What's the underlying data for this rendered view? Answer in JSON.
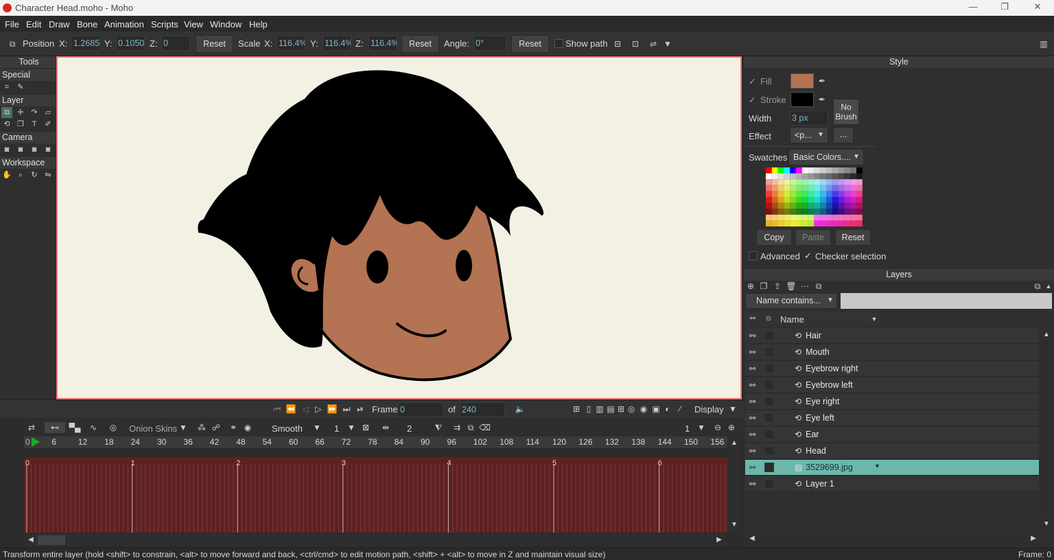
{
  "window": {
    "title": "Character Head.moho - Moho",
    "minimize": "—",
    "maximize": "❐",
    "close": "✕"
  },
  "menu": [
    "File",
    "Edit",
    "Draw",
    "Bone",
    "Animation",
    "Scripts",
    "View",
    "Window",
    "Help"
  ],
  "toolbar": {
    "position_label": "Position",
    "x_label": "X:",
    "x_value": "1.2685",
    "y_label": "Y:",
    "y_value": "0.1050",
    "z_label": "Z:",
    "z_value": "0",
    "reset1": "Reset",
    "scale_label": "Scale",
    "sx_label": "X:",
    "sx_value": "116.4%",
    "sy_label": "Y:",
    "sy_value": "116.4%",
    "sz_label": "Z:",
    "sz_value": "116.4%",
    "reset2": "Reset",
    "angle_label": "Angle:",
    "angle_value": "0°",
    "reset3": "Reset",
    "show_path": "Show path"
  },
  "tools": {
    "title": "Tools",
    "sections": [
      "Special",
      "Layer",
      "Camera",
      "Workspace"
    ]
  },
  "playback": {
    "frame_label": "Frame",
    "frame_value": "0",
    "of_label": "of",
    "total_frames": "240",
    "display": "Display"
  },
  "timeline": {
    "onion_skins": "Onion Skins",
    "interp": "Smooth",
    "interp_value": "1",
    "keys_value": "2",
    "zoom_value": "1",
    "ruler": [
      "0",
      "6",
      "12",
      "18",
      "24",
      "30",
      "36",
      "42",
      "48",
      "54",
      "60",
      "66",
      "72",
      "78",
      "84",
      "90",
      "96",
      "102",
      "108",
      "114",
      "120",
      "126",
      "132",
      "138",
      "144",
      "150",
      "156"
    ],
    "seconds": [
      "0",
      "1",
      "2",
      "3",
      "4",
      "5",
      "6"
    ]
  },
  "style": {
    "title": "Style",
    "fill_label": "Fill",
    "fill_color": "#b47352",
    "stroke_label": "Stroke",
    "stroke_color": "#000000",
    "width_label": "Width",
    "width_value": "3 px",
    "no_brush": "No Brush",
    "effect_label": "Effect",
    "effect_value": "<p...",
    "effect_more": "...",
    "swatches_label": "Swatches",
    "swatches_value": "Basic Colors....",
    "copy": "Copy",
    "paste": "Paste",
    "reset": "Reset",
    "advanced": "Advanced",
    "checker": "Checker selection"
  },
  "layers": {
    "title": "Layers",
    "filter": "Name contains...",
    "name_col": "Name",
    "items": [
      {
        "name": "Hair",
        "selected": false
      },
      {
        "name": "Mouth",
        "selected": false
      },
      {
        "name": "Eyebrow right",
        "selected": false
      },
      {
        "name": "Eyebrow left",
        "selected": false
      },
      {
        "name": "Eye right",
        "selected": false
      },
      {
        "name": "Eye left",
        "selected": false
      },
      {
        "name": "Ear",
        "selected": false
      },
      {
        "name": "Head",
        "selected": false
      },
      {
        "name": "3529699.jpg",
        "selected": true
      },
      {
        "name": "Layer 1",
        "selected": false
      }
    ]
  },
  "status": {
    "message": "Transform entire layer (hold <shift> to constrain, <alt> to move forward and back, <ctrl/cmd> to edit motion path, <shift> + <alt> to move in Z and maintain visual size)",
    "frame": "Frame: 0"
  }
}
